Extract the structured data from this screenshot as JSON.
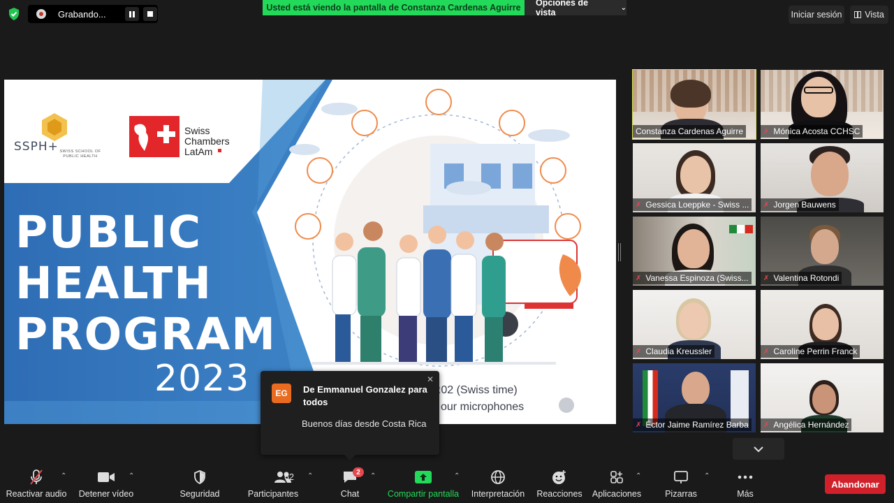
{
  "top": {
    "recording_status": "Grabando...",
    "share_banner": "Usted está viendo la pantalla de Constanza Cardenas Aguirre",
    "view_options": "Opciones de vista",
    "sign_in": "Iniciar sesión",
    "view": "Vista"
  },
  "slide": {
    "org1_name": "SSPH+",
    "org1_sub": "SWISS SCHOOL OF PUBLIC HEALTH",
    "org2_line1": "Swiss",
    "org2_line2": "Chambers",
    "org2_line3": "LatAm",
    "title_line1": "PUBLIC",
    "title_line2": "HEALTH",
    "title_line3": "PROGRAM",
    "year": "2023",
    "time_note": "7:02 (Swiss time)",
    "mic_note": "our microphones",
    "colors": {
      "blue_dark": "#2f6fb6",
      "blue_light": "#4a90d0",
      "accent_orange": "#f08a4b"
    }
  },
  "chat_popup": {
    "avatar_initials": "EG",
    "from": "De Emmanuel Gonzalez para todos",
    "message": "Buenos días desde Costa Rica"
  },
  "participants": [
    {
      "name": "Constanza Cardenas Aguirre",
      "muted": false,
      "active": true
    },
    {
      "name": "Mónica Acosta CCHSC",
      "muted": true,
      "active": false
    },
    {
      "name": "Gessica Loeppke - Swiss ...",
      "muted": true,
      "active": false
    },
    {
      "name": "Jorgen Bauwens",
      "muted": true,
      "active": false
    },
    {
      "name": "Vanessa Espinoza (Swiss...",
      "muted": true,
      "active": false
    },
    {
      "name": "Valentina Rotondi",
      "muted": true,
      "active": false
    },
    {
      "name": "Claudia Kreussler",
      "muted": true,
      "active": false
    },
    {
      "name": "Caroline Perrin Franck",
      "muted": true,
      "active": false
    },
    {
      "name": "Éctor Jaime Ramírez Barba",
      "muted": true,
      "active": false
    },
    {
      "name": "Angélica Hernández",
      "muted": true,
      "active": false
    }
  ],
  "toolbar": {
    "unmute": "Reactivar audio",
    "stop_video": "Detener vídeo",
    "security": "Seguridad",
    "participants": "Participantes",
    "participants_count": "62",
    "chat": "Chat",
    "chat_badge": "2",
    "share": "Compartir pantalla",
    "interpretation": "Interpretación",
    "reactions": "Reacciones",
    "apps": "Aplicaciones",
    "whiteboards": "Pizarras",
    "more": "Más",
    "leave": "Abandonar"
  }
}
